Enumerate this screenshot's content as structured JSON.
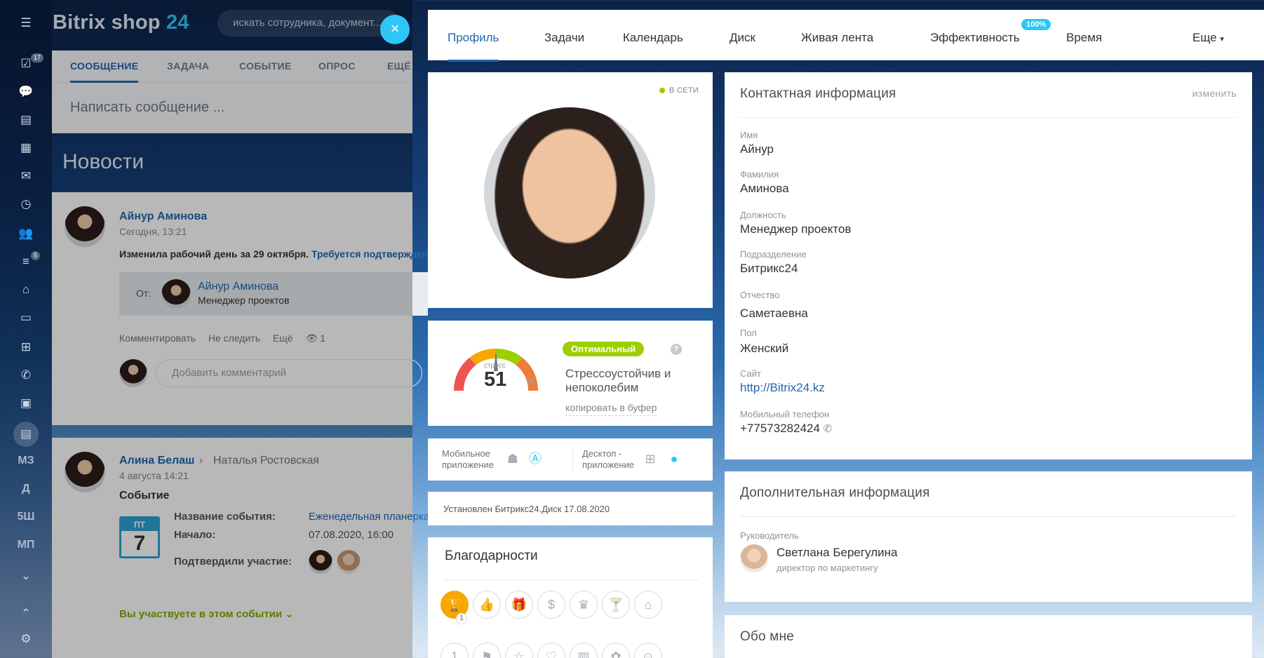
{
  "app": {
    "logo_main": "Bitrix shop",
    "logo_num": "24"
  },
  "leftbar": {
    "badges": {
      "tasks": "17",
      "filter": "5"
    },
    "text_items": [
      "МЗ",
      "Д",
      "5Ш",
      "МП"
    ]
  },
  "search": {
    "placeholder": "искать сотрудника, документ..."
  },
  "composer": {
    "tabs": [
      "СООБЩЕНИЕ",
      "ЗАДАЧА",
      "СОБЫТИЕ",
      "ОПРОС",
      "ЕЩЁ"
    ],
    "placeholder": "Написать сообщение ..."
  },
  "news": {
    "title": "Новости",
    "post1": {
      "author": "Айнур Аминова",
      "date": "Сегодня, 13:21",
      "text": "Изменила рабочий день за 29 октября.",
      "link": "Требуется подтверждение",
      "from_label": "От:",
      "from_name": "Айнур Аминова",
      "from_position": "Менеджер проектов",
      "actions": [
        "Комментировать",
        "Не следить",
        "Ещё"
      ],
      "views": "1",
      "comment_placeholder": "Добавить комментарий"
    },
    "post2": {
      "author": "Алина Белаш",
      "recipient": "Наталья Ростовская",
      "date": "4 августа 14:21",
      "type": "Событие",
      "cal_day_name": "ПТ",
      "cal_day": "7",
      "event_name_label": "Название события:",
      "event_name": "Еженедельная планерка",
      "start_label": "Начало:",
      "start_value": "07.08.2020, 16:00",
      "confirmed_label": "Подтвердили участие:",
      "participating": "Вы участвуете в этом событии"
    }
  },
  "profile": {
    "tabs": [
      "Профиль",
      "Задачи",
      "Календарь",
      "Диск",
      "Живая лента",
      "Эффективность",
      "Время",
      "Еще"
    ],
    "efficiency_badge": "100%",
    "online": "В СЕТИ",
    "stress": {
      "label": "стресс",
      "value": "51",
      "unit": "%",
      "badge": "Оптимальный",
      "description": "Стрессоустойчив и непоколебим",
      "copy": "копировать в буфер"
    },
    "apps": {
      "mobile": "Мобильное приложение",
      "desktop": "Десктоп - приложение"
    },
    "disk": "Установлен Битрикс24.Диск 17.08.2020",
    "thanks_title": "Благодарности",
    "thanks_count": "1",
    "contact": {
      "title": "Контактная информация",
      "edit": "изменить",
      "fields": [
        {
          "label": "Имя",
          "value": "Айнур"
        },
        {
          "label": "Фамилия",
          "value": "Аминова"
        },
        {
          "label": "Должность",
          "value": "Менеджер проектов"
        },
        {
          "label": "Подразделение",
          "value": "Битрикс24"
        },
        {
          "label": "Отчество",
          "value": "Саметаевна"
        },
        {
          "label": "Пол",
          "value": "Женский"
        },
        {
          "label": "Сайт",
          "value": "http://Bitrix24.kz"
        },
        {
          "label": "Мобильный телефон",
          "value": "+77573282424"
        }
      ]
    },
    "extra": {
      "title": "Дополнительная информация",
      "manager_label": "Руководитель",
      "manager_name": "Светлана Берегулина",
      "manager_position": "директор по маркетингу"
    },
    "about_title": "Обо мне"
  },
  "colors": {
    "accent": "#2067b0",
    "cyan": "#2fc6f6",
    "green": "#9dcf00",
    "gold": "#f7a700"
  }
}
